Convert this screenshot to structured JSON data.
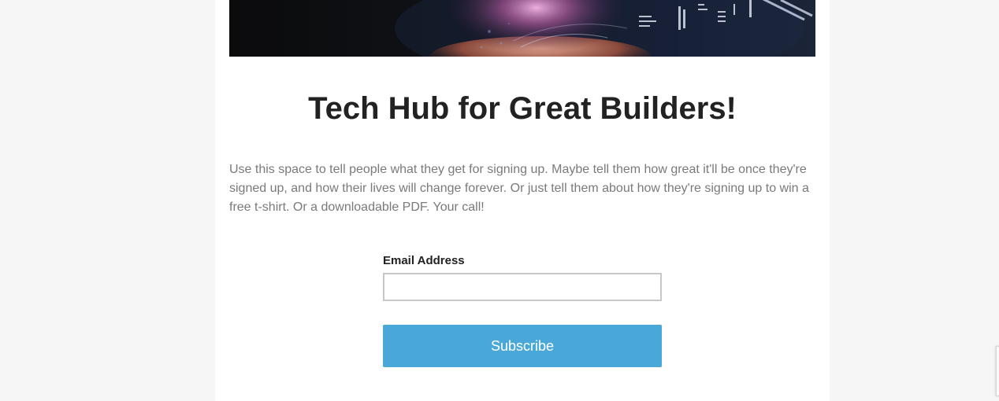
{
  "hero": {
    "image_alt": "Hand holding glowing technology interface"
  },
  "headline": "Tech Hub for Great Builders!",
  "intro_text": "Use this space to tell people what they get for signing up. Maybe tell them how great it'll be once they're signed up, and how their lives will change forever. Or just tell them about how they're signing up to win a free t-shirt. Or a downloadable PDF. Your call!",
  "form": {
    "email_label": "Email Address",
    "email_value": "",
    "email_placeholder": "",
    "subscribe_label": "Subscribe"
  },
  "colors": {
    "page_background": "#f6f6f6",
    "card_background": "#ffffff",
    "button": "#4aa8d8",
    "heading_text": "#222222",
    "body_text": "#7a7a7a"
  }
}
